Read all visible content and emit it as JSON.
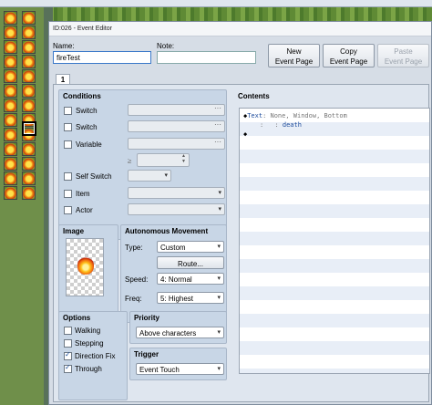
{
  "window": {
    "title": "ID:026 - Event Editor"
  },
  "header": {
    "name_label": "Name:",
    "name_value": "fireTest",
    "note_label": "Note:",
    "note_value": "",
    "new_page_line1": "New",
    "new_page_line2": "Event Page",
    "copy_page_line1": "Copy",
    "copy_page_line2": "Event Page",
    "paste_page_line1": "Paste",
    "paste_page_line2": "Event Page"
  },
  "tabs": [
    {
      "label": "1",
      "active": true
    }
  ],
  "conditions": {
    "title": "Conditions",
    "switch1_label": "Switch",
    "switch2_label": "Switch",
    "variable_label": "Variable",
    "variable_op": "≥",
    "self_switch_label": "Self Switch",
    "item_label": "Item",
    "actor_label": "Actor"
  },
  "image": {
    "title": "Image",
    "icon": "fire-sprite"
  },
  "autonomous": {
    "title": "Autonomous Movement",
    "type_label": "Type:",
    "type_value": "Custom",
    "route_label": "Route...",
    "speed_label": "Speed:",
    "speed_value": "4: Normal",
    "freq_label": "Freq:",
    "freq_value": "5: Highest"
  },
  "options": {
    "title": "Options",
    "walking_label": "Walking",
    "walking_checked": false,
    "stepping_label": "Stepping",
    "stepping_checked": false,
    "direction_fix_label": "Direction Fix",
    "direction_fix_checked": true,
    "through_label": "Through",
    "through_checked": true
  },
  "priority": {
    "title": "Priority",
    "value": "Above characters"
  },
  "trigger": {
    "title": "Trigger",
    "value": "Event Touch"
  },
  "contents": {
    "title": "Contents",
    "line1_key": "Text",
    "line1_rest": ": None, Window, Bottom",
    "line2_prefix": ":",
    "line2_mid": ":",
    "line2_text": "death"
  }
}
